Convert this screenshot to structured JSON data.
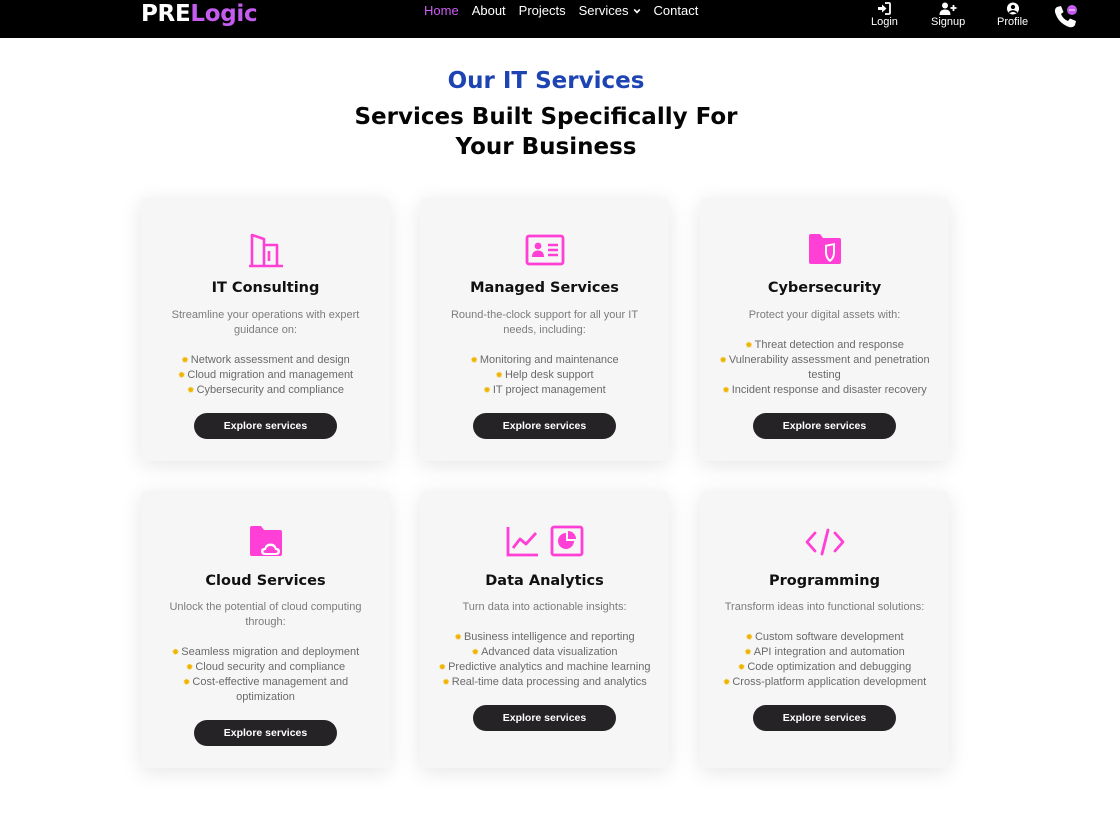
{
  "brand": {
    "part1": "PRE",
    "part2": "Logic"
  },
  "nav": [
    {
      "label": "Home",
      "active": true
    },
    {
      "label": "About"
    },
    {
      "label": "Projects"
    },
    {
      "label": "Services",
      "dropdown": true
    },
    {
      "label": "Contact"
    }
  ],
  "user_actions": {
    "login": "Login",
    "signup": "Signup",
    "profile": "Profile"
  },
  "hero": {
    "kicker": "Our IT Services",
    "title_line1": "Services Built Specifically For",
    "title_line2": "Your Business"
  },
  "colors": {
    "accent_magenta": "#ff3fd6",
    "brand_purple": "#c55cf0",
    "kicker_blue": "#1e44b3",
    "button_dark": "#262327",
    "bullet_gold": "#f0b400"
  },
  "cards": [
    {
      "icon": "building-icon",
      "title": "IT Consulting",
      "desc": "Streamline your operations with expert guidance on:",
      "items": [
        "Network assessment and design",
        "Cloud migration and management",
        "Cybersecurity and compliance"
      ],
      "button": "Explore services"
    },
    {
      "icon": "id-card-icon",
      "title": "Managed Services",
      "desc": "Round-the-clock support for all your IT needs, including:",
      "items": [
        "Monitoring and maintenance",
        "Help desk support",
        "IT project management"
      ],
      "button": "Explore services"
    },
    {
      "icon": "shield-folder-icon",
      "title": "Cybersecurity",
      "desc": "Protect your digital assets with:",
      "items": [
        "Threat detection and response",
        "Vulnerability assessment and penetration testing",
        "Incident response and disaster recovery"
      ],
      "button": "Explore services"
    },
    {
      "icon": "cloud-folder-icon",
      "title": "Cloud Services",
      "desc": "Unlock the potential of cloud computing through:",
      "items": [
        "Seamless migration and deployment",
        "Cloud security and compliance",
        "Cost-effective management and optimization"
      ],
      "button": "Explore services"
    },
    {
      "icon": "analytics-icon",
      "title": "Data Analytics",
      "desc": "Turn data into actionable insights:",
      "items": [
        "Business intelligence and reporting",
        "Advanced data visualization",
        "Predictive analytics and machine learning",
        "Real-time data processing and analytics"
      ],
      "button": "Explore services"
    },
    {
      "icon": "code-icon",
      "title": "Programming",
      "desc": "Transform ideas into functional solutions:",
      "items": [
        "Custom software development",
        "API integration and automation",
        "Code optimization and debugging",
        "Cross-platform application development"
      ],
      "button": "Explore services"
    }
  ]
}
